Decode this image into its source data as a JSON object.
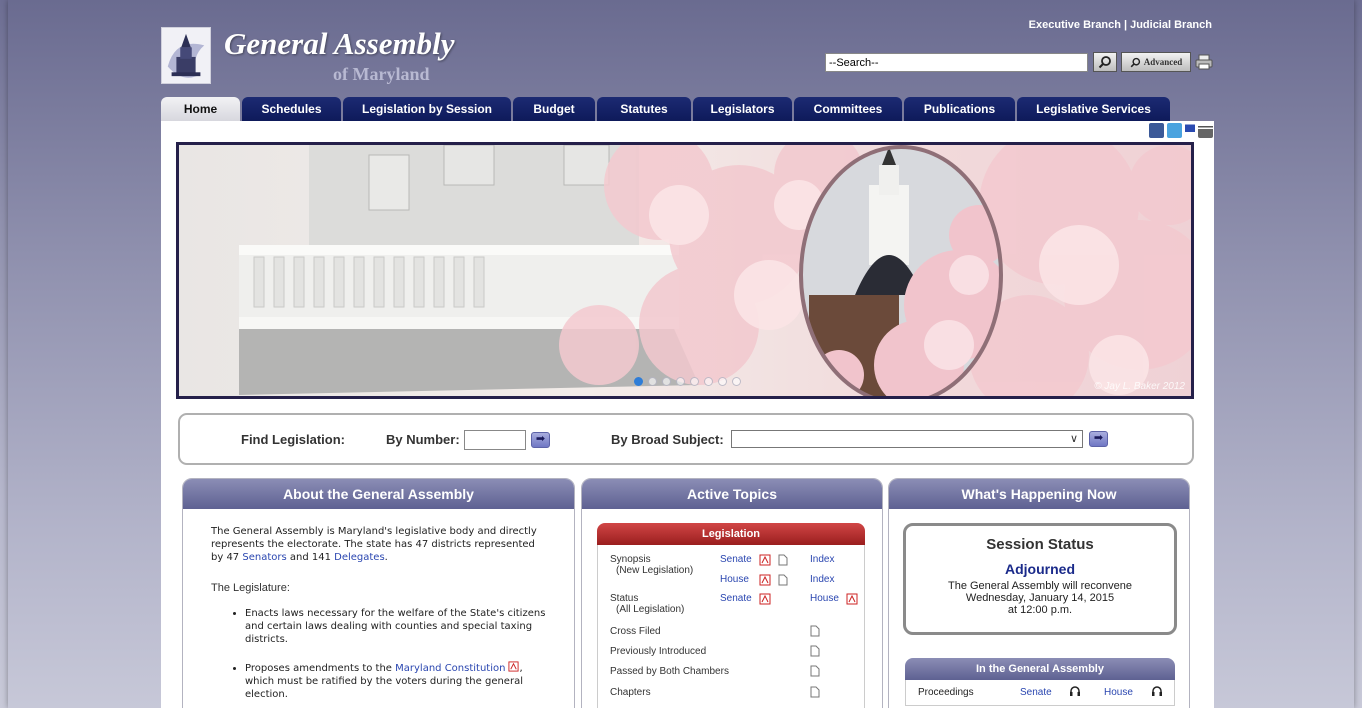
{
  "header": {
    "title": "General Assembly",
    "subtitle": "of Maryland",
    "branch_links": [
      "Executive Branch",
      "Judicial Branch"
    ],
    "search_placeholder": "--Search--",
    "advanced_label": "Advanced"
  },
  "tabs": [
    {
      "label": "Home",
      "active": true
    },
    {
      "label": "Schedules"
    },
    {
      "label": "Legislation by Session"
    },
    {
      "label": "Budget"
    },
    {
      "label": "Statutes"
    },
    {
      "label": "Legislators"
    },
    {
      "label": "Committees"
    },
    {
      "label": "Publications"
    },
    {
      "label": "Legislative Services"
    }
  ],
  "social_icons": [
    "facebook-icon",
    "twitter-icon",
    "pin-icon",
    "capitol-icon"
  ],
  "banner": {
    "credit": "© Jay L. Baker 2012",
    "slide_count": 8,
    "active_slide": 1
  },
  "find": {
    "label": "Find Legislation:",
    "by_number": "By Number:",
    "by_subject": "By Broad Subject:"
  },
  "about": {
    "heading": "About the General Assembly",
    "intro_1": "The General Assembly is Maryland's legislative body and directly represents the electorate. The state has 47 districts represented by 47 ",
    "senators": "Senators",
    "intro_2": " and 141 ",
    "delegates": "Delegates",
    "intro_3": ".",
    "sub": "The Legislature:",
    "item_1": "Enacts laws necessary for the welfare of the State's citizens and certain laws dealing with counties and special taxing districts.",
    "item_2a": "Proposes amendments to the ",
    "item_2_link": "Maryland Constitution",
    "item_2b": ", which must be ratified by the voters during the general election."
  },
  "active_topics": {
    "heading": "Active Topics",
    "legislation_heading": "Legislation",
    "synopsis": "Synopsis",
    "synopsis_sub": "(New Legislation)",
    "senate": "Senate",
    "house": "House",
    "index": "Index",
    "status": "Status",
    "status_sub": "(All Legislation)",
    "cross_filed": "Cross Filed",
    "previously_introduced": "Previously Introduced",
    "passed_both": "Passed by Both Chambers",
    "chapters": "Chapters"
  },
  "happening": {
    "heading": "What's Happening Now",
    "session_status": "Session Status",
    "status_value": "Adjourned",
    "note_1": "The General Assembly will reconvene",
    "note_2": "Wednesday, January 14, 2015",
    "note_3": "at 12:00 p.m.",
    "in_ga": "In the General Assembly",
    "proceedings": "Proceedings",
    "senate": "Senate",
    "house": "House"
  }
}
